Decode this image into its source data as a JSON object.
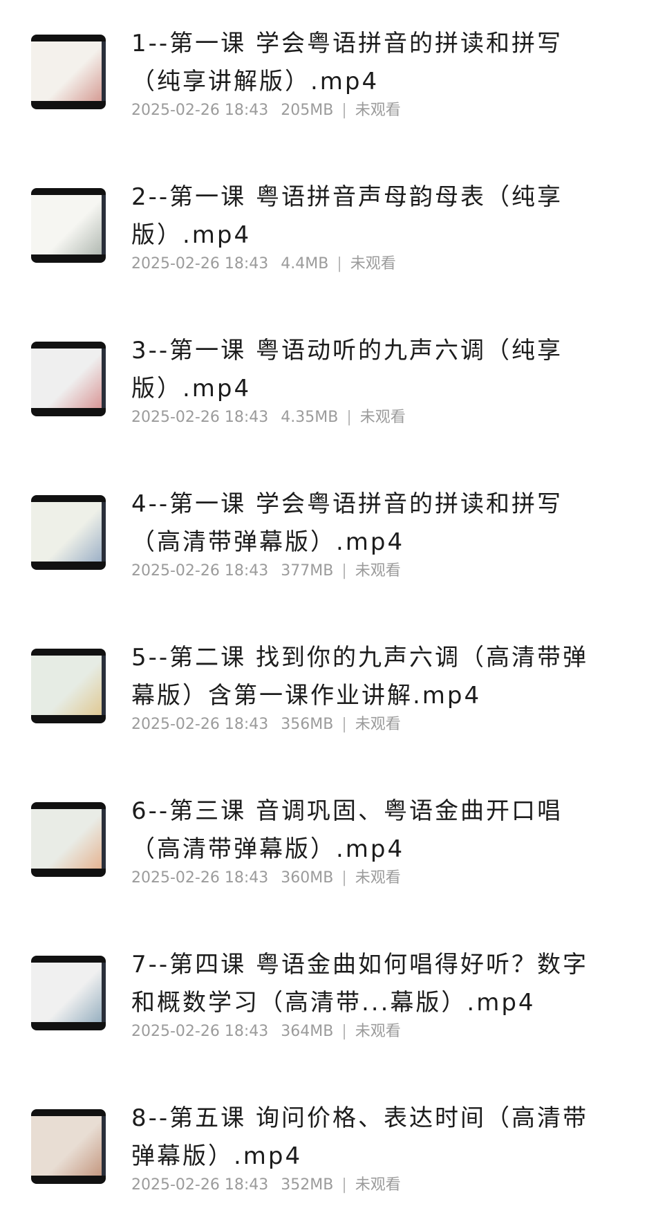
{
  "videos": [
    {
      "title": "1--第一课 学会粤语拼音的拼读和拼写（纯享讲解版）.mp4",
      "date": "2025-02-26 18:43",
      "size": "205MB",
      "status": "未观看",
      "thumb_color": "#f4f1ec",
      "thumb_accent": "#b6463c"
    },
    {
      "title": "2--第一课 粤语拼音声母韵母表（纯享版）.mp4",
      "date": "2025-02-26 18:43",
      "size": "4.4MB",
      "status": "未观看",
      "thumb_color": "#f6f6f2",
      "thumb_accent": "#6b7b70"
    },
    {
      "title": "3--第一课 粤语动听的九声六调（纯享版）.mp4",
      "date": "2025-02-26 18:43",
      "size": "4.35MB",
      "status": "未观看",
      "thumb_color": "#efefef",
      "thumb_accent": "#c23b3b"
    },
    {
      "title": "4--第一课 学会粤语拼音的拼读和拼写（高清带弹幕版）.mp4",
      "date": "2025-02-26 18:43",
      "size": "377MB",
      "status": "未观看",
      "thumb_color": "#eef0e8",
      "thumb_accent": "#4a6fa5"
    },
    {
      "title": "5--第二课 找到你的九声六调（高清带弹幕版）含第一课作业讲解.mp4",
      "date": "2025-02-26 18:43",
      "size": "356MB",
      "status": "未观看",
      "thumb_color": "#e6ece4",
      "thumb_accent": "#d9a441"
    },
    {
      "title": "6--第三课 音调巩固、粤语金曲开口唱（高清带弹幕版）.mp4",
      "date": "2025-02-26 18:43",
      "size": "360MB",
      "status": "未观看",
      "thumb_color": "#e9ece6",
      "thumb_accent": "#e07a3c"
    },
    {
      "title": "7--第四课 粤语金曲如何唱得好听？数字和概数学习（高清带...幕版）.mp4",
      "date": "2025-02-26 18:43",
      "size": "364MB",
      "status": "未观看",
      "thumb_color": "#f0f0f0",
      "thumb_accent": "#3c6e8f"
    },
    {
      "title": "8--第五课 询问价格、表达时间（高清带弹幕版）.mp4",
      "date": "2025-02-26 18:43",
      "size": "352MB",
      "status": "未观看",
      "thumb_color": "#e8ddd3",
      "thumb_accent": "#a0522d"
    }
  ]
}
